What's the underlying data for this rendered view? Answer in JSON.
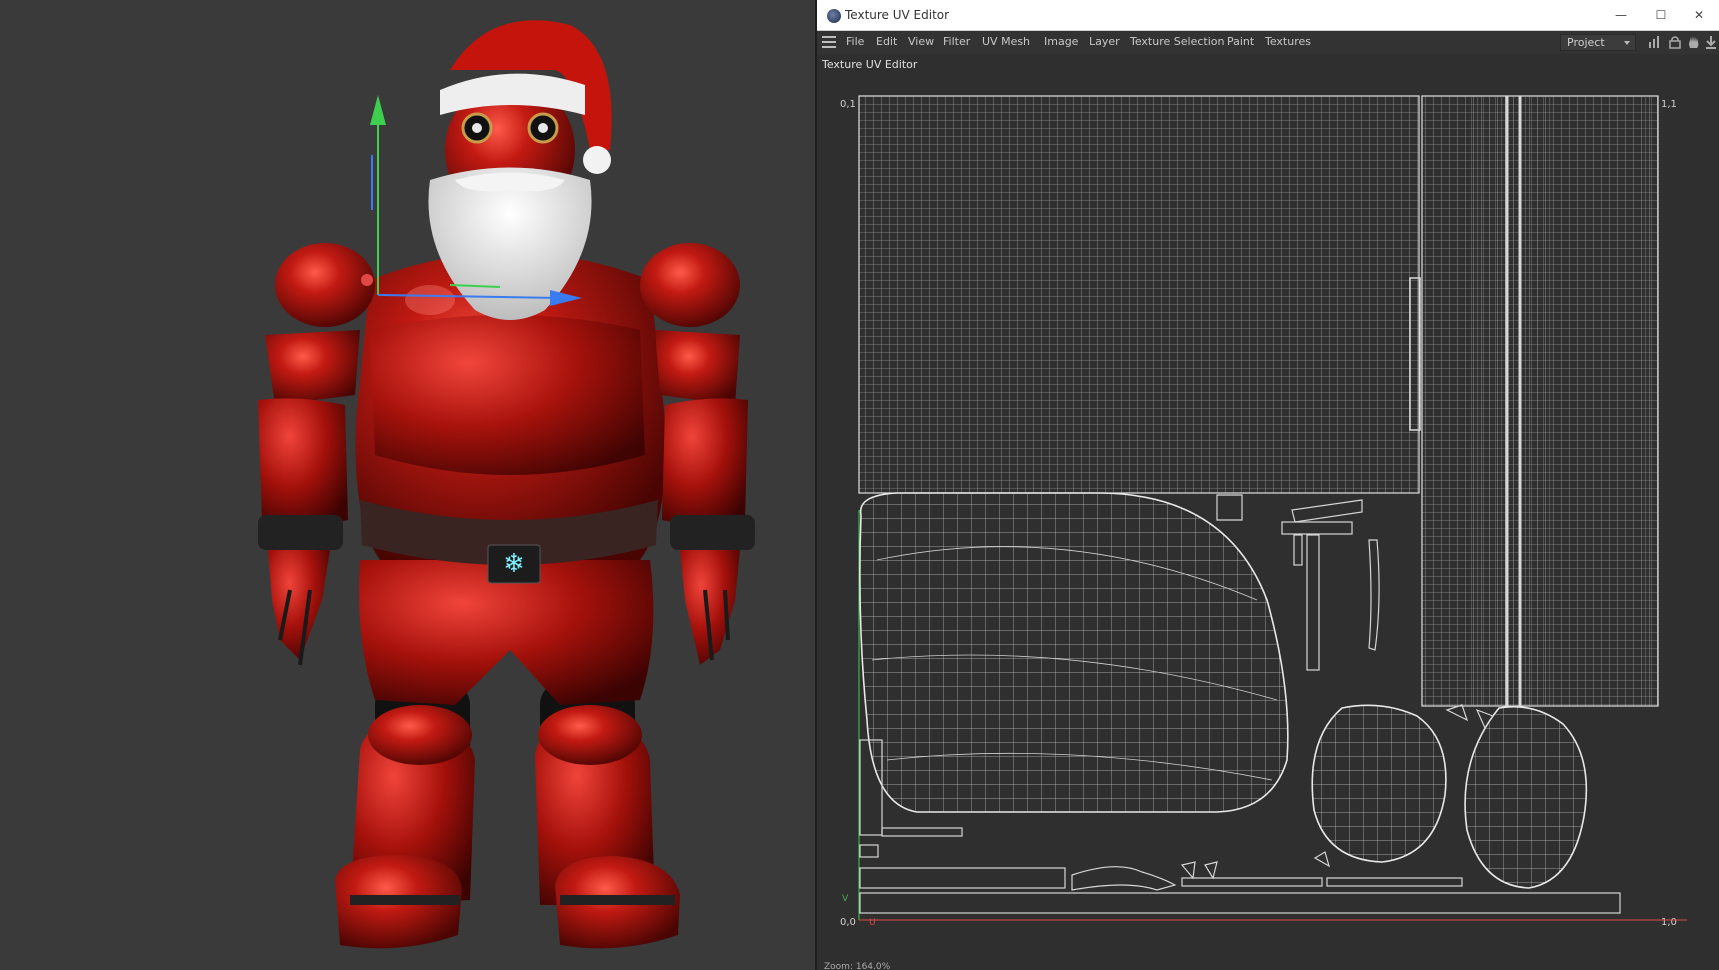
{
  "window": {
    "title": "Texture UV Editor",
    "minimize_glyph": "—",
    "maximize_glyph": "☐",
    "close_glyph": "✕"
  },
  "menu": {
    "items": [
      "File",
      "Edit",
      "View",
      "Filter",
      "UV Mesh",
      "Image",
      "Layer",
      "Texture Selection",
      "Paint",
      "Textures"
    ],
    "project_value": "Project"
  },
  "panel": {
    "label": "Texture UV Editor"
  },
  "uv": {
    "corner_top_left": "0,1",
    "corner_top_right": "1,1",
    "corner_bottom_left": "0,0",
    "corner_bottom_right": "1,0",
    "v_axis": "V",
    "u_axis": "U"
  },
  "status": {
    "zoom": "Zoom: 164.0%"
  },
  "colors": {
    "uv_wire": "#d8d8d8",
    "axis_green": "#3ecf4f",
    "axis_blue": "#3a7cf0",
    "axis_red": "#e04848",
    "suit_red": "#b3140f"
  },
  "icons": [
    "menu-icon",
    "chart-icon",
    "lock-icon",
    "hand-icon",
    "download-icon"
  ]
}
